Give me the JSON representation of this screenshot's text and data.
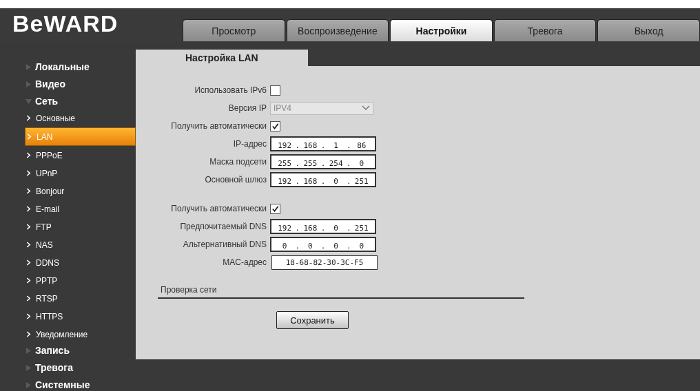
{
  "logo": "BeWARD",
  "tabs": [
    {
      "label": "Просмотр",
      "selected": false
    },
    {
      "label": "Воспроизведение",
      "selected": false
    },
    {
      "label": "Настройки",
      "selected": true
    },
    {
      "label": "Тревога",
      "selected": false
    },
    {
      "label": "Выход",
      "selected": false
    }
  ],
  "sidebar": {
    "items": [
      {
        "label": "Локальные",
        "expanded": false
      },
      {
        "label": "Видео",
        "expanded": false
      },
      {
        "label": "Сеть",
        "expanded": true,
        "children": [
          {
            "label": "Основные",
            "selected": false
          },
          {
            "label": "LAN",
            "selected": true
          },
          {
            "label": "PPPoE",
            "selected": false
          },
          {
            "label": "UPnP",
            "selected": false
          },
          {
            "label": "Bonjour",
            "selected": false
          },
          {
            "label": "E-mail",
            "selected": false
          },
          {
            "label": "FTP",
            "selected": false
          },
          {
            "label": "NAS",
            "selected": false
          },
          {
            "label": "DDNS",
            "selected": false
          },
          {
            "label": "PPTP",
            "selected": false
          },
          {
            "label": "RTSP",
            "selected": false
          },
          {
            "label": "HTTPS",
            "selected": false
          },
          {
            "label": "Уведомление",
            "selected": false
          }
        ]
      },
      {
        "label": "Запись",
        "expanded": false
      },
      {
        "label": "Тревога",
        "expanded": false
      },
      {
        "label": "Системные",
        "expanded": false
      }
    ]
  },
  "panel": {
    "title": "Настройка LAN",
    "groups": [
      [
        {
          "kind": "checkbox",
          "label": "Использовать IPv6",
          "checked": false
        },
        {
          "kind": "select",
          "label": "Версия IP",
          "value": "IPV4",
          "disabled": true
        },
        {
          "kind": "checkbox",
          "label": "Получить автоматически",
          "checked": true
        },
        {
          "kind": "ip",
          "label": "IP-адрес",
          "octets": [
            "192",
            "168",
            "1",
            "86"
          ]
        },
        {
          "kind": "ip",
          "label": "Маска подсети",
          "octets": [
            "255",
            "255",
            "254",
            "0"
          ]
        },
        {
          "kind": "ip",
          "label": "Основной шлюз",
          "octets": [
            "192",
            "168",
            "0",
            "251"
          ]
        }
      ],
      [
        {
          "kind": "checkbox",
          "label": "Получить автоматически",
          "checked": true
        },
        {
          "kind": "ip",
          "label": "Предпочитаемый DNS",
          "octets": [
            "192",
            "168",
            "0",
            "251"
          ]
        },
        {
          "kind": "ip",
          "label": "Альтернативный DNS",
          "octets": [
            "0",
            "0",
            "0",
            "0"
          ]
        },
        {
          "kind": "text",
          "label": "MAC-адрес",
          "value": "18-68-82-30-3C-F5"
        }
      ]
    ],
    "octet_separator": ".",
    "section": "Проверка сети",
    "save_button": "Сохранить"
  }
}
